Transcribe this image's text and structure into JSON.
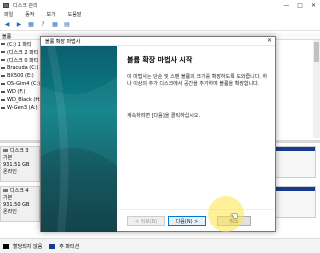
{
  "window": {
    "title": "디스크 관리",
    "controls": [
      "—",
      "□",
      "✕"
    ]
  },
  "menu": [
    "파일",
    "동작",
    "보기",
    "도움말"
  ],
  "toolbar": {
    "icons": [
      "back-arrow-icon",
      "forward-arrow-icon",
      "grid-icon",
      "help-icon",
      "grid-icon",
      "properties-icon"
    ]
  },
  "volumes": {
    "header": "볼륨",
    "items": [
      "(C:) 1 파티",
      "(디스크 2 파티",
      "(디스크 0 파티",
      "Bracuda (C:)",
      "BX500 (E:)",
      "OS-Gim4 (C:)",
      "WD (F:)",
      "WD_Black (H:)",
      "W-Gen3 (A:)"
    ]
  },
  "disks": [
    {
      "name": "디스크 3",
      "type": "기본",
      "size": "931.51 GB",
      "status": "온라인"
    },
    {
      "name": "디스크 4",
      "type": "기본",
      "size": "931.50 GB",
      "status": "온라인"
    }
  ],
  "status": {
    "legend": [
      {
        "label": "할당되지 않음",
        "color": "#000000"
      },
      {
        "label": "주 파티션",
        "color": "#1a3a8f"
      }
    ]
  },
  "wizard": {
    "title": "볼륨 확장 마법사",
    "close": "✕",
    "heading": "볼륨 확장 마법사 시작",
    "description": "이 마법사는 단순 및 스팬 볼륨의 크기를 확장하도록 도와줍니다. 하나 이상의 추가 디스크에서 공간을 추가하여 볼륨을 확장합니다.",
    "next_hint": "계속하려면 [다음]을 클릭하십시오.",
    "buttons": {
      "back": "< 뒤로(B)",
      "next": "다음(N) >",
      "cancel": "취소"
    }
  }
}
